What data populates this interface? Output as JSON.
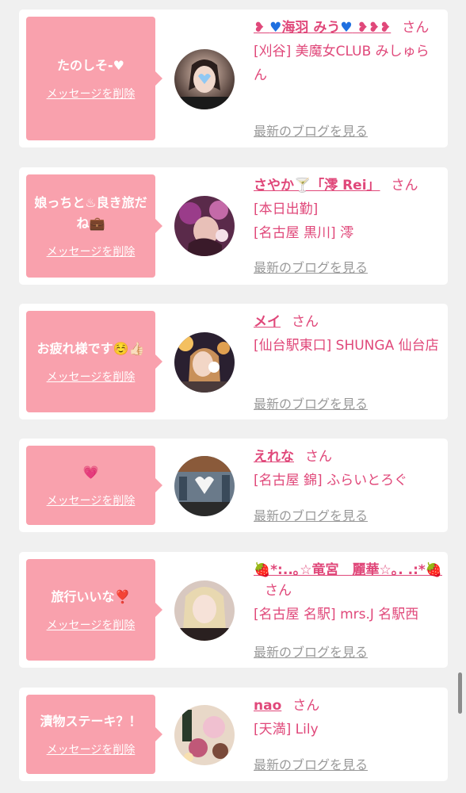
{
  "cards": [
    {
      "message": "たのしそ-♥",
      "delete_label": "メッセージを削除",
      "name_pre": "❥ ",
      "name_main": "海羽 みう",
      "name_post": " ❥❥❥",
      "honorific": "さん",
      "shop_lines": [
        "[刈谷] 美魔女CLUB みしゅらん"
      ],
      "blog_label": "最新のブログを見る"
    },
    {
      "message": "娘っちと♨良き旅だね💼",
      "delete_label": "メッセージを削除",
      "name": "さやか🍸「澪 Rei」",
      "honorific": "さん",
      "shop_lines": [
        "[本日出勤]",
        "[名古屋 黒川] 澪"
      ],
      "blog_label": "最新のブログを見る"
    },
    {
      "message": "お疲れ様です☺️👍🏻",
      "delete_label": "メッセージを削除",
      "name": "メイ",
      "honorific": "さん",
      "shop_lines": [
        "[仙台駅東口] SHUNGA 仙台店"
      ],
      "blog_label": "最新のブログを見る"
    },
    {
      "message": "💗",
      "delete_label": "メッセージを削除",
      "name": "えれな",
      "honorific": "さん",
      "shop_lines": [
        "[名古屋 錦] ふらいとろぐ"
      ],
      "blog_label": "最新のブログを見る"
    },
    {
      "message": "旅行いいな❣️",
      "delete_label": "メッセージを削除",
      "name": "🍓*:..｡☆竜宮　麗華☆｡. .:*🍓",
      "honorific": "さん",
      "shop_lines": [
        "[名古屋 名駅] mrs.J 名駅西"
      ],
      "blog_label": "最新のブログを見る"
    },
    {
      "message": "漬物ステーキ？！",
      "delete_label": "メッセージを削除",
      "name": "nao",
      "honorific": "さん",
      "shop_lines": [
        "[天満] Lily"
      ],
      "blog_label": "最新のブログを見る"
    }
  ],
  "colors": {
    "page_bg": "#f0f0f0",
    "bubble": "#f9a1ad",
    "link_pink": "#e0487a",
    "muted": "#999999"
  }
}
